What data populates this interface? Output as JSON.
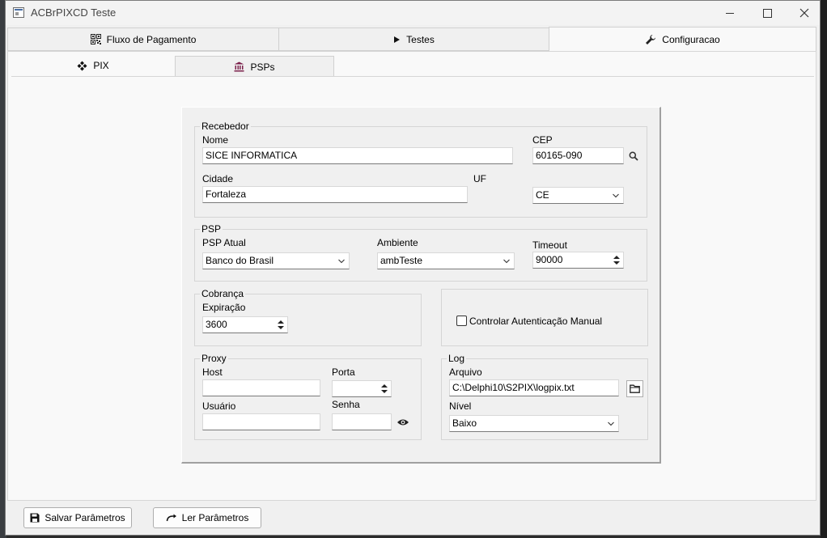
{
  "window": {
    "title": "ACBrPIXCD Teste"
  },
  "main_tabs": [
    {
      "label": "Fluxo de Pagamento",
      "icon": "qr-code-icon"
    },
    {
      "label": "Testes",
      "icon": "play-icon"
    },
    {
      "label": "Configuracao",
      "icon": "wrench-icon"
    }
  ],
  "sub_tabs": [
    {
      "label": "PIX",
      "icon": "pix-logo-icon"
    },
    {
      "label": "PSPs",
      "icon": "bank-icon"
    }
  ],
  "recebedor": {
    "group_label": "Recebedor",
    "nome_label": "Nome",
    "nome_value": "SICE INFORMATICA",
    "cep_label": "CEP",
    "cep_value": "60165-090",
    "cidade_label": "Cidade",
    "cidade_value": "Fortaleza",
    "uf_label": "UF",
    "uf_value": "CE"
  },
  "psp": {
    "group_label": "PSP",
    "atual_label": "PSP Atual",
    "atual_value": "Banco do Brasil",
    "ambiente_label": "Ambiente",
    "ambiente_value": "ambTeste",
    "timeout_label": "Timeout",
    "timeout_value": "90000"
  },
  "cobranca": {
    "group_label": "Cobrança",
    "expiracao_label": "Expiração",
    "expiracao_value": "3600"
  },
  "auth": {
    "checkbox_label": "Controlar Autenticação Manual",
    "checked": false
  },
  "proxy": {
    "group_label": "Proxy",
    "host_label": "Host",
    "host_value": "",
    "porta_label": "Porta",
    "porta_value": "",
    "usuario_label": "Usuário",
    "usuario_value": "",
    "senha_label": "Senha",
    "senha_value": ""
  },
  "log": {
    "group_label": "Log",
    "arquivo_label": "Arquivo",
    "arquivo_value": "C:\\Delphi10\\S2PIX\\logpix.txt",
    "nivel_label": "Nível",
    "nivel_value": "Baixo"
  },
  "buttons": {
    "salvar_label": "Salvar Parâmetros",
    "ler_label": "Ler Parâmetros"
  }
}
